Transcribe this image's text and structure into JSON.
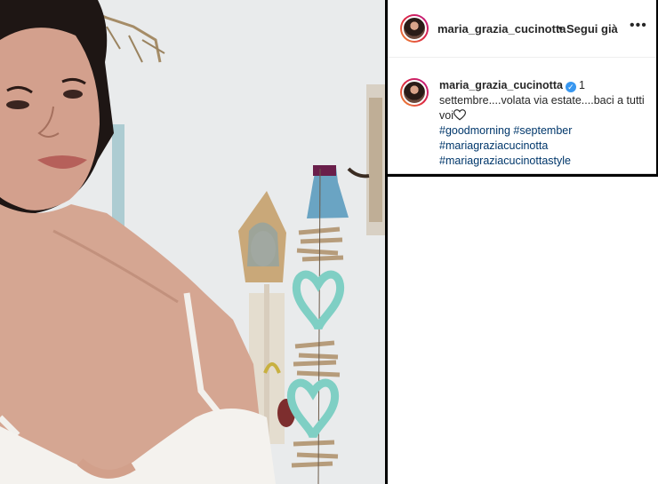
{
  "post": {
    "username": "maria_grazia_cucinotta",
    "follow_separator": "•",
    "follow_label": "Segui già",
    "more_label": "•••",
    "caption": {
      "username": "maria_grazia_cucinotta",
      "text": "1 settembre....volata via estate....baci a tutti voi",
      "hashtags": [
        "#goodmorning",
        "#september",
        "#mariagraziacucinotta",
        "#mariagraziacucinottastyle"
      ]
    }
  },
  "icons": {
    "verified": "verified-badge-icon",
    "heart": "heart-outline-icon",
    "more": "more-options-icon"
  },
  "colors": {
    "accent": "#3897f0",
    "hashtag": "#00376b",
    "text": "#262626"
  }
}
